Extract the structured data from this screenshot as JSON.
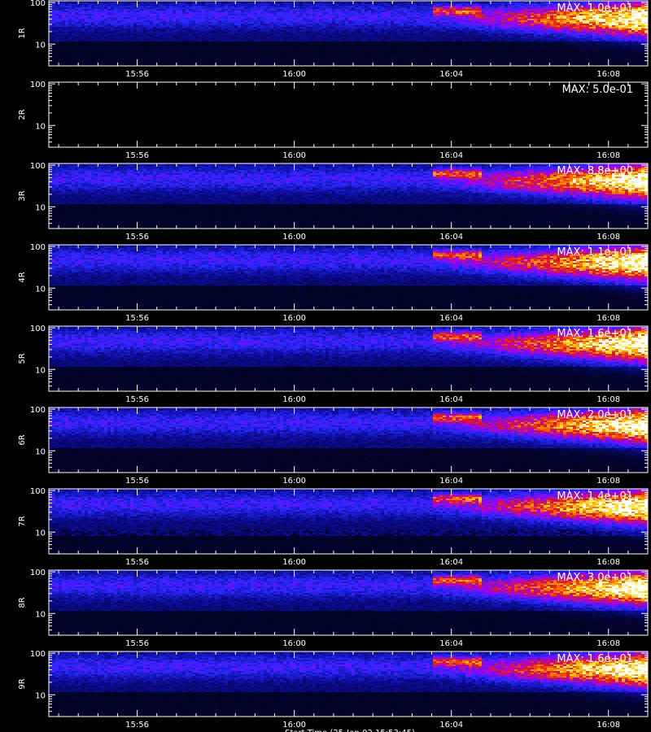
{
  "chart_data": {
    "type": "heatmap",
    "x_axis": {
      "ticks": [
        "15:56",
        "16:00",
        "16:04",
        "16:08"
      ],
      "tick_minutes": [
        956,
        960,
        964,
        968
      ],
      "range_minutes": [
        953.75,
        969.0
      ],
      "footer_label": "Start Time (25-Jan-02 15:53:45)"
    },
    "y_axis": {
      "scale": "log",
      "range": [
        3,
        110
      ],
      "ticks": [
        "10",
        "100"
      ],
      "tick_values": [
        10,
        100
      ]
    },
    "colormap": [
      "#000000",
      "#0a0a8c",
      "#2828ff",
      "#a000ff",
      "#e01818",
      "#ff7a00",
      "#ffe020",
      "#ffffff"
    ],
    "panels": [
      {
        "label": "1R",
        "max_text": "MAX: 1.0e+01",
        "active": true
      },
      {
        "label": "2R",
        "max_text": "MAX: 5.0e-01",
        "active": false
      },
      {
        "label": "3R",
        "max_text": "MAX: 8.8e+00",
        "active": true
      },
      {
        "label": "4R",
        "max_text": "MAX: 1.1e+01",
        "active": true
      },
      {
        "label": "5R",
        "max_text": "MAX: 1.6e+01",
        "active": true
      },
      {
        "label": "6R",
        "max_text": "MAX: 2.0e+01",
        "active": true
      },
      {
        "label": "7R",
        "max_text": "MAX: 1.4e+01",
        "active": true
      },
      {
        "label": "8R",
        "max_text": "MAX: 3.0e+01",
        "active": true
      },
      {
        "label": "9R",
        "max_text": "MAX: 1.6e+01",
        "active": true
      }
    ]
  }
}
